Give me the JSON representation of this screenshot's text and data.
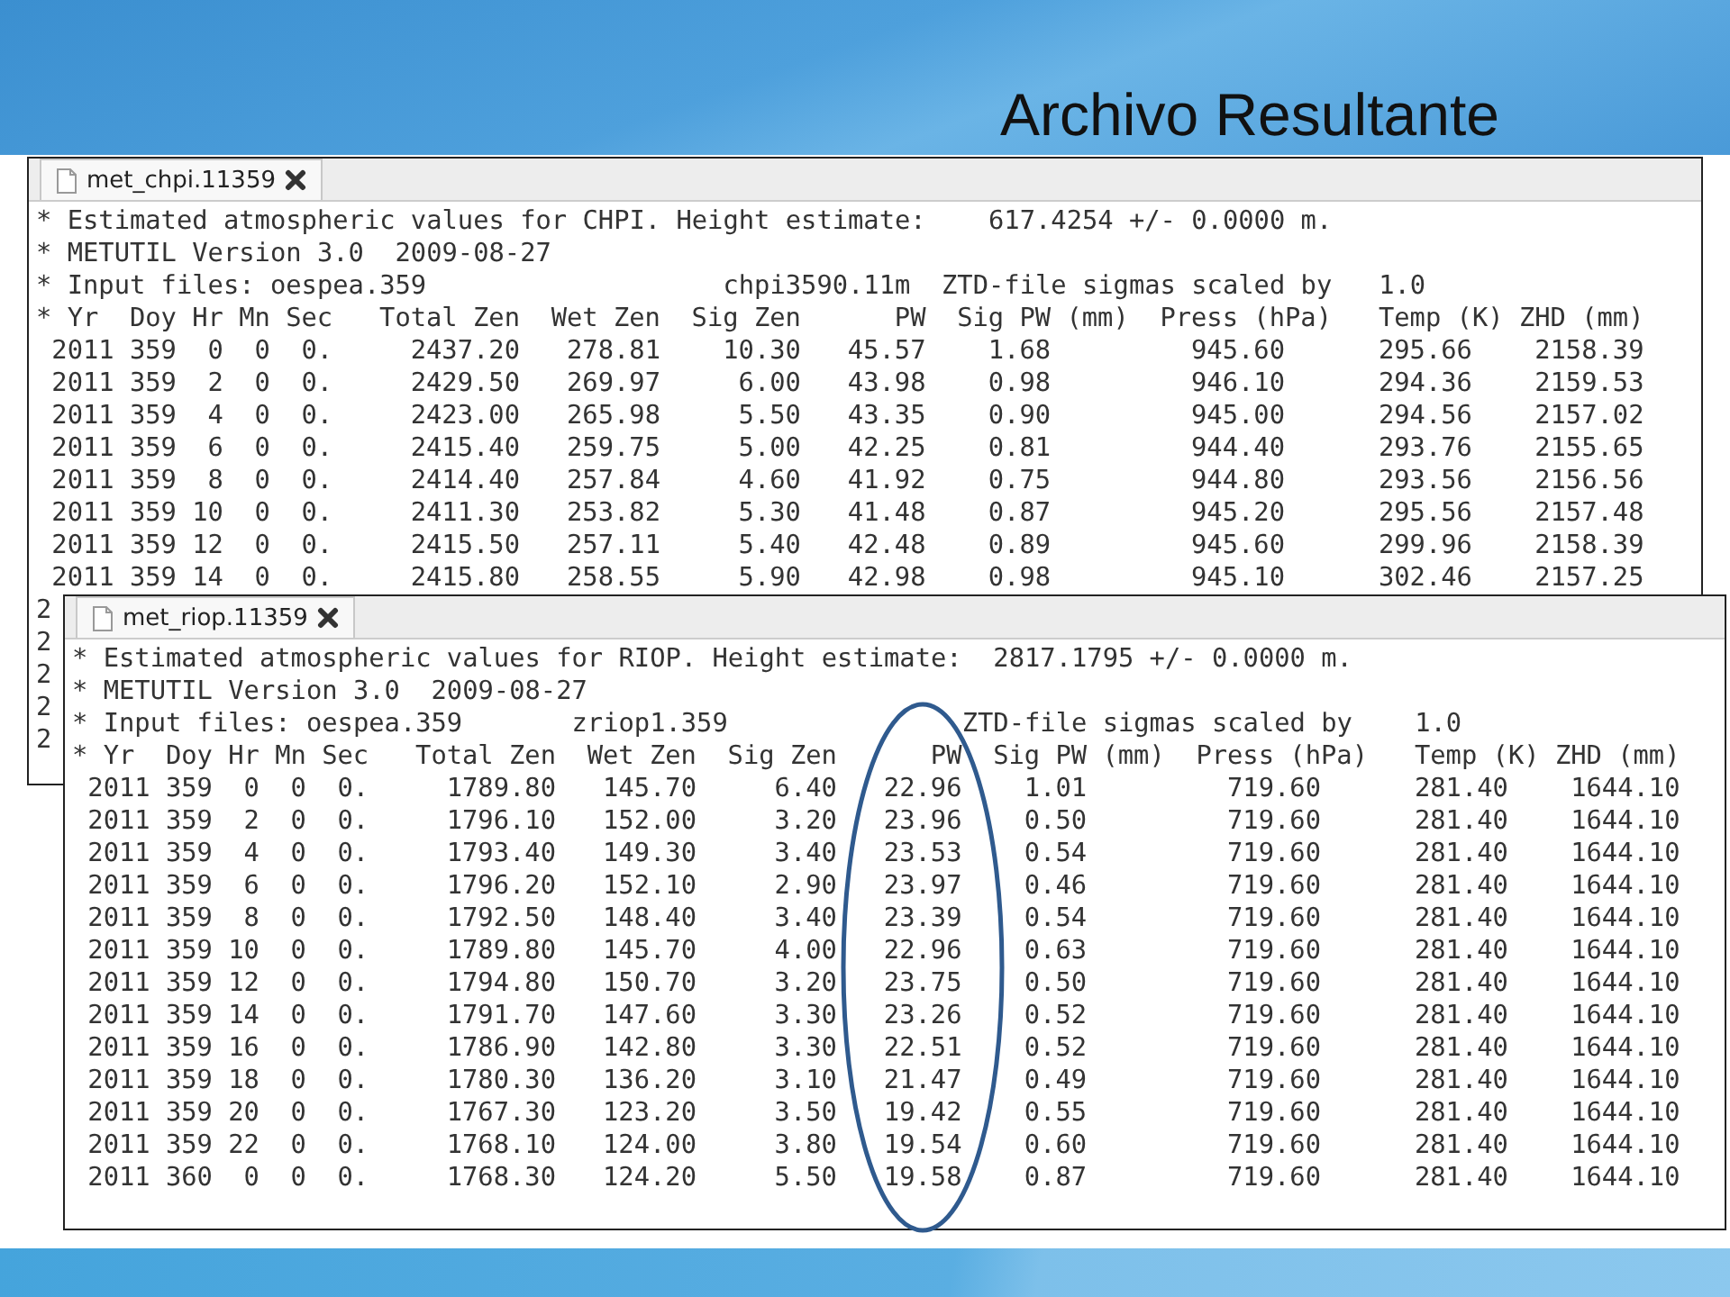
{
  "slide": {
    "title": "Archivo Resultante"
  },
  "windows": [
    {
      "tab": {
        "label": "met_chpi.11359",
        "selected": true
      },
      "lines": [
        "* Estimated atmospheric values for CHPI. Height estimate:    617.4254 +/- 0.0000 m.",
        "* METUTIL Version 3.0  2009-08-27",
        "* Input files: oespea.359                   chpi3590.11m  ZTD-file sigmas scaled by   1.0"
      ],
      "columns": [
        "* Yr",
        "Doy",
        "Hr",
        "Mn",
        "Sec",
        "Total Zen",
        "Wet Zen",
        "Sig Zen",
        "PW",
        "Sig PW (mm)",
        "Press (hPa)",
        "Temp (K)",
        "ZHD (mm)"
      ],
      "rows": [
        [
          "2011",
          "359",
          "0",
          "0",
          "0.",
          "2437.20",
          "278.81",
          "10.30",
          "45.57",
          "1.68",
          "945.60",
          "295.66",
          "2158.39"
        ],
        [
          "2011",
          "359",
          "2",
          "0",
          "0.",
          "2429.50",
          "269.97",
          "6.00",
          "43.98",
          "0.98",
          "946.10",
          "294.36",
          "2159.53"
        ],
        [
          "2011",
          "359",
          "4",
          "0",
          "0.",
          "2423.00",
          "265.98",
          "5.50",
          "43.35",
          "0.90",
          "945.00",
          "294.56",
          "2157.02"
        ],
        [
          "2011",
          "359",
          "6",
          "0",
          "0.",
          "2415.40",
          "259.75",
          "5.00",
          "42.25",
          "0.81",
          "944.40",
          "293.76",
          "2155.65"
        ],
        [
          "2011",
          "359",
          "8",
          "0",
          "0.",
          "2414.40",
          "257.84",
          "4.60",
          "41.92",
          "0.75",
          "944.80",
          "293.56",
          "2156.56"
        ],
        [
          "2011",
          "359",
          "10",
          "0",
          "0.",
          "2411.30",
          "253.82",
          "5.30",
          "41.48",
          "0.87",
          "945.20",
          "295.56",
          "2157.48"
        ],
        [
          "2011",
          "359",
          "12",
          "0",
          "0.",
          "2415.50",
          "257.11",
          "5.40",
          "42.48",
          "0.89",
          "945.60",
          "299.96",
          "2158.39"
        ],
        [
          "2011",
          "359",
          "14",
          "0",
          "0.",
          "2415.80",
          "258.55",
          "5.90",
          "42.98",
          "0.98",
          "945.10",
          "302.46",
          "2157.25"
        ],
        [
          "2"
        ],
        [
          "2"
        ],
        [
          "2"
        ],
        [
          "2"
        ],
        [
          "2"
        ]
      ]
    },
    {
      "tab": {
        "label": "met_riop.11359",
        "selected": true
      },
      "lines": [
        "* Estimated atmospheric values for RIOP. Height estimate:  2817.1795 +/- 0.0000 m.",
        "* METUTIL Version 3.0  2009-08-27",
        "* Input files: oespea.359       zriop1.359               ZTD-file sigmas scaled by    1.0"
      ],
      "columns": [
        "* Yr",
        "Doy",
        "Hr",
        "Mn",
        "Sec",
        "Total Zen",
        "Wet Zen",
        "Sig Zen",
        "PW",
        "Sig PW (mm)",
        "Press (hPa)",
        "Temp (K)",
        "ZHD (mm)"
      ],
      "rows": [
        [
          "2011",
          "359",
          "0",
          "0",
          "0.",
          "1789.80",
          "145.70",
          "6.40",
          "22.96",
          "1.01",
          "719.60",
          "281.40",
          "1644.10"
        ],
        [
          "2011",
          "359",
          "2",
          "0",
          "0.",
          "1796.10",
          "152.00",
          "3.20",
          "23.96",
          "0.50",
          "719.60",
          "281.40",
          "1644.10"
        ],
        [
          "2011",
          "359",
          "4",
          "0",
          "0.",
          "1793.40",
          "149.30",
          "3.40",
          "23.53",
          "0.54",
          "719.60",
          "281.40",
          "1644.10"
        ],
        [
          "2011",
          "359",
          "6",
          "0",
          "0.",
          "1796.20",
          "152.10",
          "2.90",
          "23.97",
          "0.46",
          "719.60",
          "281.40",
          "1644.10"
        ],
        [
          "2011",
          "359",
          "8",
          "0",
          "0.",
          "1792.50",
          "148.40",
          "3.40",
          "23.39",
          "0.54",
          "719.60",
          "281.40",
          "1644.10"
        ],
        [
          "2011",
          "359",
          "10",
          "0",
          "0.",
          "1789.80",
          "145.70",
          "4.00",
          "22.96",
          "0.63",
          "719.60",
          "281.40",
          "1644.10"
        ],
        [
          "2011",
          "359",
          "12",
          "0",
          "0.",
          "1794.80",
          "150.70",
          "3.20",
          "23.75",
          "0.50",
          "719.60",
          "281.40",
          "1644.10"
        ],
        [
          "2011",
          "359",
          "14",
          "0",
          "0.",
          "1791.70",
          "147.60",
          "3.30",
          "23.26",
          "0.52",
          "719.60",
          "281.40",
          "1644.10"
        ],
        [
          "2011",
          "359",
          "16",
          "0",
          "0.",
          "1786.90",
          "142.80",
          "3.30",
          "22.51",
          "0.52",
          "719.60",
          "281.40",
          "1644.10"
        ],
        [
          "2011",
          "359",
          "18",
          "0",
          "0.",
          "1780.30",
          "136.20",
          "3.10",
          "21.47",
          "0.49",
          "719.60",
          "281.40",
          "1644.10"
        ],
        [
          "2011",
          "359",
          "20",
          "0",
          "0.",
          "1767.30",
          "123.20",
          "3.50",
          "19.42",
          "0.55",
          "719.60",
          "281.40",
          "1644.10"
        ],
        [
          "2011",
          "359",
          "22",
          "0",
          "0.",
          "1768.10",
          "124.00",
          "3.80",
          "19.54",
          "0.60",
          "719.60",
          "281.40",
          "1644.10"
        ],
        [
          "2011",
          "360",
          "0",
          "0",
          "0.",
          "1768.30",
          "124.20",
          "5.50",
          "19.58",
          "0.87",
          "719.60",
          "281.40",
          "1644.10"
        ]
      ]
    }
  ]
}
